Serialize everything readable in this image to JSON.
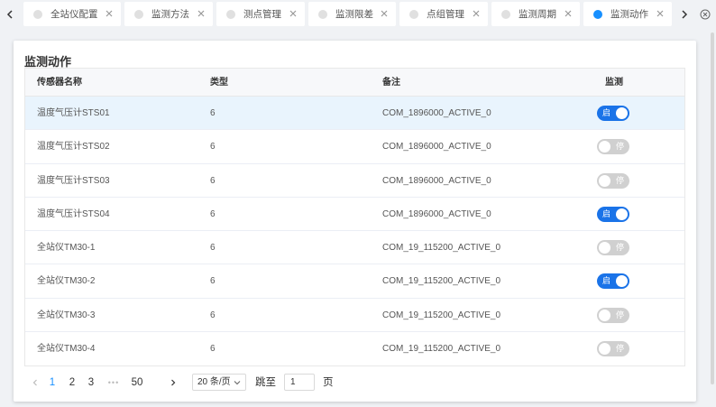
{
  "tabs": [
    {
      "label": "全站仪配置",
      "active": false
    },
    {
      "label": "监测方法",
      "active": false
    },
    {
      "label": "测点管理",
      "active": false
    },
    {
      "label": "监测限差",
      "active": false
    },
    {
      "label": "点组管理",
      "active": false
    },
    {
      "label": "监测周期",
      "active": false
    },
    {
      "label": "监测动作",
      "active": true
    }
  ],
  "nav": {
    "prev_icon": "chevron-left-icon",
    "next_icon": "chevron-right-icon",
    "close_all_icon": "close-circle-icon"
  },
  "page": {
    "title": "监测动作"
  },
  "table": {
    "headers": [
      "传感器名称",
      "类型",
      "备注",
      "监测"
    ],
    "rows": [
      {
        "name": "温度气压计STS01",
        "type": "6",
        "note": "COM_1896000_ACTIVE_0",
        "monitor": true,
        "switch_label": "启"
      },
      {
        "name": "温度气压计STS02",
        "type": "6",
        "note": "COM_1896000_ACTIVE_0",
        "monitor": false,
        "switch_label": "停"
      },
      {
        "name": "温度气压计STS03",
        "type": "6",
        "note": "COM_1896000_ACTIVE_0",
        "monitor": false,
        "switch_label": "停"
      },
      {
        "name": "温度气压计STS04",
        "type": "6",
        "note": "COM_1896000_ACTIVE_0",
        "monitor": true,
        "switch_label": "启"
      },
      {
        "name": "全站仪TM30-1",
        "type": "6",
        "note": "COM_19_115200_ACTIVE_0",
        "monitor": false,
        "switch_label": "停"
      },
      {
        "name": "全站仪TM30-2",
        "type": "6",
        "note": "COM_19_115200_ACTIVE_0",
        "monitor": true,
        "switch_label": "启"
      },
      {
        "name": "全站仪TM30-3",
        "type": "6",
        "note": "COM_19_115200_ACTIVE_0",
        "monitor": false,
        "switch_label": "停"
      },
      {
        "name": "全站仪TM30-4",
        "type": "6",
        "note": "COM_19_115200_ACTIVE_0",
        "monitor": false,
        "switch_label": "停"
      }
    ]
  },
  "pagination": {
    "pages": [
      "1",
      "2",
      "3"
    ],
    "ellipsis": "•••",
    "last": "50",
    "current": "1",
    "page_size": "20 条/页",
    "jump_label": "跳至",
    "jump_value": "1",
    "page_suffix": "页"
  },
  "colors": {
    "accent": "#1890ff",
    "switch_on": "#1a73e8",
    "switch_off": "#d0d0d0",
    "row_highlight": "#e9f4fd"
  }
}
